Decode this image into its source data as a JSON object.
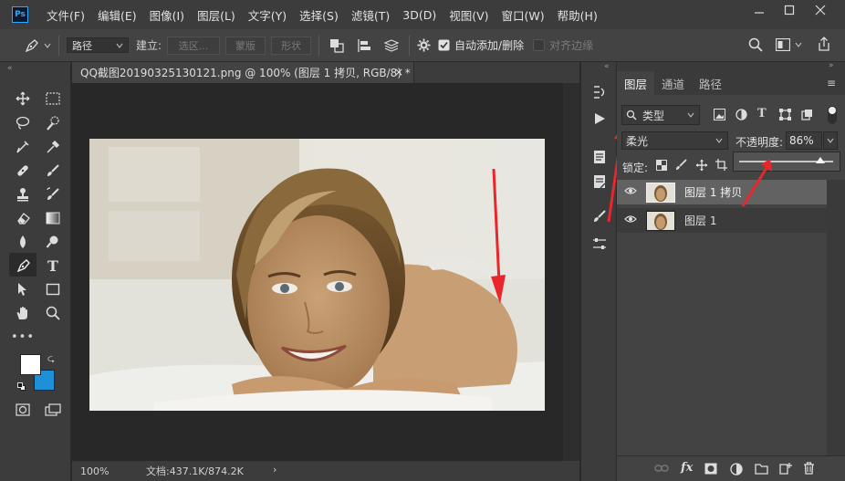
{
  "app": {
    "logo": "Ps"
  },
  "menu": [
    "文件(F)",
    "编辑(E)",
    "图像(I)",
    "图层(L)",
    "文字(Y)",
    "选择(S)",
    "滤镜(T)",
    "3D(D)",
    "视图(V)",
    "窗口(W)",
    "帮助(H)"
  ],
  "options": {
    "mode": "路径",
    "make_label": "建立:",
    "selection_btn": "选区...",
    "mask_btn": "蒙版",
    "shape_btn": "形状",
    "auto_add_delete": "自动添加/删除",
    "align_edges": "对齐边缘"
  },
  "document": {
    "tab_title": "QQ截图20190325130121.png @ 100% (图层 1 拷贝, RGB/8) *",
    "zoom": "100%",
    "doc_size": "文档:437.1K/874.2K"
  },
  "layers_panel": {
    "tabs": [
      "图层",
      "通道",
      "路径"
    ],
    "filter_kind": "类型",
    "blend_mode": "柔光",
    "opacity_label": "不透明度:",
    "opacity_value": "86%",
    "opacity_level_percent": 86,
    "lock_label": "锁定:",
    "layers": [
      {
        "name": "图层 1 拷贝",
        "selected": true,
        "visible": true
      },
      {
        "name": "图层 1",
        "selected": false,
        "visible": true
      }
    ]
  },
  "icons": [
    "pen-tool-icon",
    "eye-icon",
    "search-icon",
    "gear-icon",
    "share-icon",
    "trash-icon",
    "link-icon",
    "fx-icon",
    "mask-icon",
    "folder-icon",
    "new-layer-icon",
    "adjustment-icon"
  ],
  "colors": {
    "accent": "#31a8ff",
    "annotation_arrow": "#e8262b",
    "foreground": "#ffffff",
    "background": "#1e90d8"
  }
}
